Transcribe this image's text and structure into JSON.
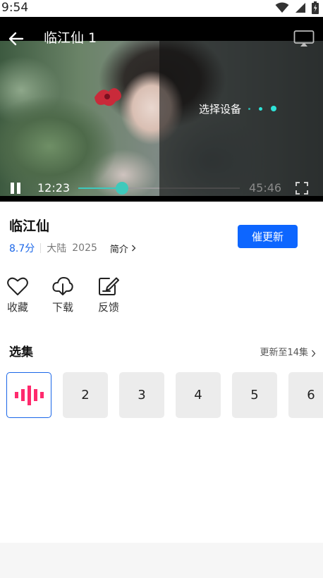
{
  "status_bar": {
    "time": "9:54"
  },
  "player": {
    "title": "临江仙 1",
    "cast_label": "选择设备",
    "current_time": "12:23",
    "total_time": "45:46",
    "progress_fraction": 0.27,
    "buffer_fraction": 0.5
  },
  "info": {
    "title": "临江仙",
    "score": "8.7分",
    "region": "大陆",
    "year": "2025",
    "intro_label": "简介",
    "remind_button": "催更新"
  },
  "actions": [
    {
      "icon": "heart-icon",
      "label": "收藏"
    },
    {
      "icon": "download-icon",
      "label": "下载"
    },
    {
      "icon": "edit-icon",
      "label": "反馈"
    }
  ],
  "episodes": {
    "header": "选集",
    "update_info": "更新至14集",
    "items": [
      {
        "label": "",
        "current": true,
        "icon": "playing-bars-icon"
      },
      {
        "label": "2"
      },
      {
        "label": "3"
      },
      {
        "label": "4"
      },
      {
        "label": "5"
      },
      {
        "label": "6"
      }
    ]
  },
  "colors": {
    "accent_blue": "#0d66ff",
    "progress_teal": "#3fc9bb",
    "playing_pink": "#ff2a6d"
  }
}
